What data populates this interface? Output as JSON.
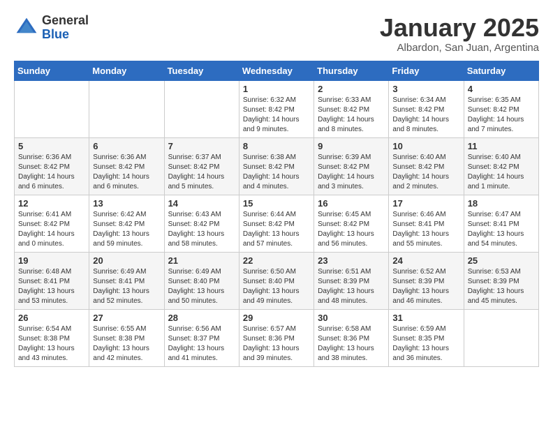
{
  "logo": {
    "general": "General",
    "blue": "Blue"
  },
  "header": {
    "month": "January 2025",
    "location": "Albardon, San Juan, Argentina"
  },
  "weekdays": [
    "Sunday",
    "Monday",
    "Tuesday",
    "Wednesday",
    "Thursday",
    "Friday",
    "Saturday"
  ],
  "weeks": [
    [
      {
        "day": "",
        "sunrise": "",
        "sunset": "",
        "daylight": ""
      },
      {
        "day": "",
        "sunrise": "",
        "sunset": "",
        "daylight": ""
      },
      {
        "day": "",
        "sunrise": "",
        "sunset": "",
        "daylight": ""
      },
      {
        "day": "1",
        "sunrise": "Sunrise: 6:32 AM",
        "sunset": "Sunset: 8:42 PM",
        "daylight": "Daylight: 14 hours and 9 minutes."
      },
      {
        "day": "2",
        "sunrise": "Sunrise: 6:33 AM",
        "sunset": "Sunset: 8:42 PM",
        "daylight": "Daylight: 14 hours and 8 minutes."
      },
      {
        "day": "3",
        "sunrise": "Sunrise: 6:34 AM",
        "sunset": "Sunset: 8:42 PM",
        "daylight": "Daylight: 14 hours and 8 minutes."
      },
      {
        "day": "4",
        "sunrise": "Sunrise: 6:35 AM",
        "sunset": "Sunset: 8:42 PM",
        "daylight": "Daylight: 14 hours and 7 minutes."
      }
    ],
    [
      {
        "day": "5",
        "sunrise": "Sunrise: 6:36 AM",
        "sunset": "Sunset: 8:42 PM",
        "daylight": "Daylight: 14 hours and 6 minutes."
      },
      {
        "day": "6",
        "sunrise": "Sunrise: 6:36 AM",
        "sunset": "Sunset: 8:42 PM",
        "daylight": "Daylight: 14 hours and 6 minutes."
      },
      {
        "day": "7",
        "sunrise": "Sunrise: 6:37 AM",
        "sunset": "Sunset: 8:42 PM",
        "daylight": "Daylight: 14 hours and 5 minutes."
      },
      {
        "day": "8",
        "sunrise": "Sunrise: 6:38 AM",
        "sunset": "Sunset: 8:42 PM",
        "daylight": "Daylight: 14 hours and 4 minutes."
      },
      {
        "day": "9",
        "sunrise": "Sunrise: 6:39 AM",
        "sunset": "Sunset: 8:42 PM",
        "daylight": "Daylight: 14 hours and 3 minutes."
      },
      {
        "day": "10",
        "sunrise": "Sunrise: 6:40 AM",
        "sunset": "Sunset: 8:42 PM",
        "daylight": "Daylight: 14 hours and 2 minutes."
      },
      {
        "day": "11",
        "sunrise": "Sunrise: 6:40 AM",
        "sunset": "Sunset: 8:42 PM",
        "daylight": "Daylight: 14 hours and 1 minute."
      }
    ],
    [
      {
        "day": "12",
        "sunrise": "Sunrise: 6:41 AM",
        "sunset": "Sunset: 8:42 PM",
        "daylight": "Daylight: 14 hours and 0 minutes."
      },
      {
        "day": "13",
        "sunrise": "Sunrise: 6:42 AM",
        "sunset": "Sunset: 8:42 PM",
        "daylight": "Daylight: 13 hours and 59 minutes."
      },
      {
        "day": "14",
        "sunrise": "Sunrise: 6:43 AM",
        "sunset": "Sunset: 8:42 PM",
        "daylight": "Daylight: 13 hours and 58 minutes."
      },
      {
        "day": "15",
        "sunrise": "Sunrise: 6:44 AM",
        "sunset": "Sunset: 8:42 PM",
        "daylight": "Daylight: 13 hours and 57 minutes."
      },
      {
        "day": "16",
        "sunrise": "Sunrise: 6:45 AM",
        "sunset": "Sunset: 8:42 PM",
        "daylight": "Daylight: 13 hours and 56 minutes."
      },
      {
        "day": "17",
        "sunrise": "Sunrise: 6:46 AM",
        "sunset": "Sunset: 8:41 PM",
        "daylight": "Daylight: 13 hours and 55 minutes."
      },
      {
        "day": "18",
        "sunrise": "Sunrise: 6:47 AM",
        "sunset": "Sunset: 8:41 PM",
        "daylight": "Daylight: 13 hours and 54 minutes."
      }
    ],
    [
      {
        "day": "19",
        "sunrise": "Sunrise: 6:48 AM",
        "sunset": "Sunset: 8:41 PM",
        "daylight": "Daylight: 13 hours and 53 minutes."
      },
      {
        "day": "20",
        "sunrise": "Sunrise: 6:49 AM",
        "sunset": "Sunset: 8:41 PM",
        "daylight": "Daylight: 13 hours and 52 minutes."
      },
      {
        "day": "21",
        "sunrise": "Sunrise: 6:49 AM",
        "sunset": "Sunset: 8:40 PM",
        "daylight": "Daylight: 13 hours and 50 minutes."
      },
      {
        "day": "22",
        "sunrise": "Sunrise: 6:50 AM",
        "sunset": "Sunset: 8:40 PM",
        "daylight": "Daylight: 13 hours and 49 minutes."
      },
      {
        "day": "23",
        "sunrise": "Sunrise: 6:51 AM",
        "sunset": "Sunset: 8:39 PM",
        "daylight": "Daylight: 13 hours and 48 minutes."
      },
      {
        "day": "24",
        "sunrise": "Sunrise: 6:52 AM",
        "sunset": "Sunset: 8:39 PM",
        "daylight": "Daylight: 13 hours and 46 minutes."
      },
      {
        "day": "25",
        "sunrise": "Sunrise: 6:53 AM",
        "sunset": "Sunset: 8:39 PM",
        "daylight": "Daylight: 13 hours and 45 minutes."
      }
    ],
    [
      {
        "day": "26",
        "sunrise": "Sunrise: 6:54 AM",
        "sunset": "Sunset: 8:38 PM",
        "daylight": "Daylight: 13 hours and 43 minutes."
      },
      {
        "day": "27",
        "sunrise": "Sunrise: 6:55 AM",
        "sunset": "Sunset: 8:38 PM",
        "daylight": "Daylight: 13 hours and 42 minutes."
      },
      {
        "day": "28",
        "sunrise": "Sunrise: 6:56 AM",
        "sunset": "Sunset: 8:37 PM",
        "daylight": "Daylight: 13 hours and 41 minutes."
      },
      {
        "day": "29",
        "sunrise": "Sunrise: 6:57 AM",
        "sunset": "Sunset: 8:36 PM",
        "daylight": "Daylight: 13 hours and 39 minutes."
      },
      {
        "day": "30",
        "sunrise": "Sunrise: 6:58 AM",
        "sunset": "Sunset: 8:36 PM",
        "daylight": "Daylight: 13 hours and 38 minutes."
      },
      {
        "day": "31",
        "sunrise": "Sunrise: 6:59 AM",
        "sunset": "Sunset: 8:35 PM",
        "daylight": "Daylight: 13 hours and 36 minutes."
      },
      {
        "day": "",
        "sunrise": "",
        "sunset": "",
        "daylight": ""
      }
    ]
  ]
}
